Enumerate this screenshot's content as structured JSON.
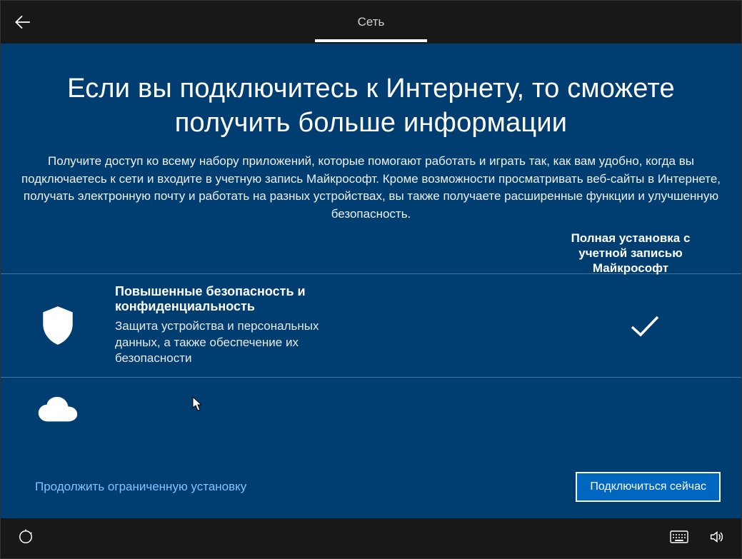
{
  "header": {
    "title": "Сеть"
  },
  "intro": {
    "heading": "Если вы подключитесь к Интернету, то сможете получить больше информации",
    "description": "Получите доступ ко всему набору приложений, которые помогают работать и играть так, как вам удобно, когда вы подключаетесь к сети и входите в учетную запись Майкрософт. Кроме возможности просматривать веб-сайты в Интернете, получать электронную почту и работать на разных устройствах, вы также получаете расширенные функции и улучшенную безопасность."
  },
  "column_header": "Полная установка с учетной записью Майкрософт",
  "rows": [
    {
      "icon": "shield",
      "title": "Повышенные безопасность и конфиденциальность",
      "subtitle": "Защита устройства и персональных данных, а также обеспечение их безопасности",
      "checked": true
    },
    {
      "icon": "cloud",
      "title": "",
      "subtitle": "",
      "checked": false
    }
  ],
  "actions": {
    "continue_limited": "Продолжить ограниченную установку",
    "connect_now": "Подключиться сейчас"
  }
}
